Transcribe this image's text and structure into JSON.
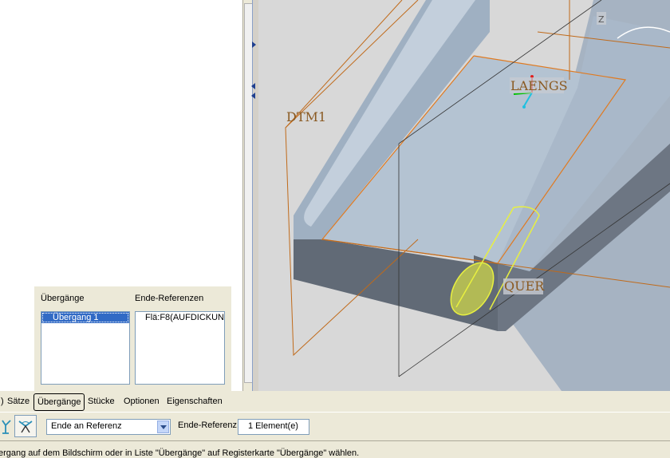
{
  "transitions_panel": {
    "transitions_label": "Übergänge",
    "transitions": [
      "Übergang 1"
    ],
    "end_refs_label": "Ende-Referenzen",
    "end_refs": [
      "Flä:F8(AUFDICKUNG"
    ]
  },
  "tabs": [
    "Sätze",
    "Übergänge",
    "Stücke",
    "Optionen",
    "Eigenschaften"
  ],
  "active_tab": "Übergänge",
  "tab_prefix_glyph": ")",
  "toolbar": {
    "icons": [
      "transition-type-icon",
      "end-transition-icon"
    ],
    "transition_type_value": "Ende an Referenz",
    "end_ref_label": "Ende-Referenz",
    "end_ref_value": "1 Element(e)"
  },
  "viewport": {
    "labels": {
      "dtm1": "DTM1",
      "laengs": "LAENGS",
      "quer": "QUER",
      "z": "Z"
    }
  },
  "status_message": "ergang auf dem Bildschirm oder in Liste \"Übergänge\" auf Registerkarte \"Übergänge\" wählen.",
  "colors": {
    "selection": "#316ac5",
    "datum": "#c06a1a",
    "highlight": "#e8f040",
    "part_top": "#b4c3d2",
    "part_side": "#616a76",
    "viewport_bg": "#d8d8d8"
  }
}
